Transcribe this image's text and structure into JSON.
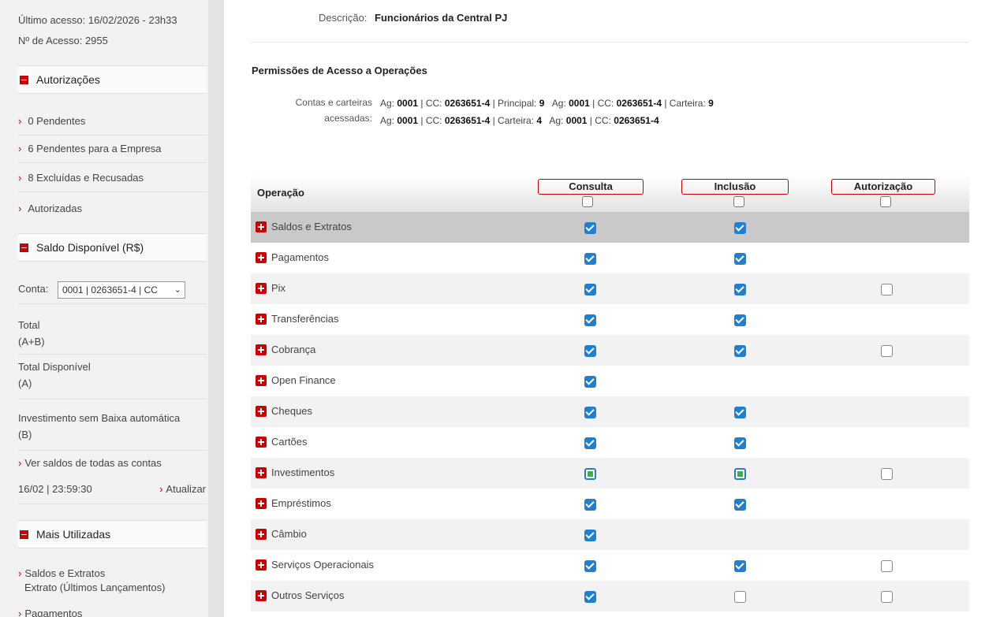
{
  "sidebar": {
    "last_access": "Último acesso: 16/02/2026 - 23h33",
    "access_count": "Nº de Acesso: 2955",
    "autorizacoes": {
      "title": "Autorizações",
      "items": [
        {
          "label": "0 Pendentes"
        },
        {
          "label": "6 Pendentes para a Empresa"
        },
        {
          "label": "8 Excluídas e Recusadas"
        },
        {
          "label": "Autorizadas"
        }
      ]
    },
    "saldo": {
      "title": "Saldo Disponível (R$)",
      "conta_label": "Conta:",
      "conta_value": "0001 | 0263651-4 | CC",
      "total_label": "Total",
      "total_sub": "(A+B)",
      "disponivel_label": "Total Disponível",
      "disponivel_sub": "(A)",
      "invest_label": "Investimento sem Baixa automática",
      "invest_sub": "(B)",
      "ver_saldos": "Ver saldos de todas as contas",
      "timestamp": "16/02 | 23:59:30",
      "atualizar": "Atualizar"
    },
    "mais_utilizadas": {
      "title": "Mais Utilizadas",
      "item1_line1": "Saldos e Extratos",
      "item1_line2": "Extrato (Últimos Lançamentos)",
      "item2": "Pagamentos"
    }
  },
  "main": {
    "descricao_label": "Descrição:",
    "descricao_value": "Funcionários da Central PJ",
    "permissions_title": "Permissões de Acesso a Operações",
    "contas_label_1": "Contas e carteiras",
    "contas_label_2": "acessadas:",
    "contas_line1": [
      {
        "t": "Ag: ",
        "b": false
      },
      {
        "t": "0001",
        "b": true
      },
      {
        "t": " | CC: ",
        "b": false
      },
      {
        "t": "0263651-4",
        "b": true
      },
      {
        "t": " | Principal: ",
        "b": false
      },
      {
        "t": "9",
        "b": true
      },
      {
        "t": "   Ag: ",
        "b": false
      },
      {
        "t": "0001",
        "b": true
      },
      {
        "t": " | CC: ",
        "b": false
      },
      {
        "t": "0263651-4",
        "b": true
      },
      {
        "t": " | Carteira: ",
        "b": false
      },
      {
        "t": "9",
        "b": true
      }
    ],
    "contas_line2": [
      {
        "t": "Ag: ",
        "b": false
      },
      {
        "t": "0001",
        "b": true
      },
      {
        "t": " | CC: ",
        "b": false
      },
      {
        "t": "0263651-4",
        "b": true
      },
      {
        "t": " | Carteira: ",
        "b": false
      },
      {
        "t": "4",
        "b": true
      },
      {
        "t": "   Ag: ",
        "b": false
      },
      {
        "t": "0001",
        "b": true
      },
      {
        "t": " | CC: ",
        "b": false
      },
      {
        "t": "0263651-4",
        "b": true
      }
    ],
    "table": {
      "col_operacao": "Operação",
      "col_consulta": "Consulta",
      "col_inclusao": "Inclusão",
      "col_autorizacao": "Autorização",
      "rows": [
        {
          "name": "Saldos e Extratos",
          "consulta": "checked",
          "inclusao": "checked",
          "autorizacao": "none"
        },
        {
          "name": "Pagamentos",
          "consulta": "checked",
          "inclusao": "checked",
          "autorizacao": "none"
        },
        {
          "name": "Pix",
          "consulta": "checked",
          "inclusao": "checked",
          "autorizacao": "unchecked"
        },
        {
          "name": "Transferências",
          "consulta": "checked",
          "inclusao": "checked",
          "autorizacao": "none"
        },
        {
          "name": "Cobrança",
          "consulta": "checked",
          "inclusao": "checked",
          "autorizacao": "unchecked"
        },
        {
          "name": "Open Finance",
          "consulta": "checked",
          "inclusao": "none",
          "autorizacao": "none"
        },
        {
          "name": "Cheques",
          "consulta": "checked",
          "inclusao": "checked",
          "autorizacao": "none"
        },
        {
          "name": "Cartões",
          "consulta": "checked",
          "inclusao": "checked",
          "autorizacao": "none"
        },
        {
          "name": "Investimentos",
          "consulta": "partial",
          "inclusao": "partial",
          "autorizacao": "unchecked"
        },
        {
          "name": "Empréstimos",
          "consulta": "checked",
          "inclusao": "checked",
          "autorizacao": "none"
        },
        {
          "name": "Câmbio",
          "consulta": "checked",
          "inclusao": "none",
          "autorizacao": "none"
        },
        {
          "name": "Serviços Operacionais",
          "consulta": "checked",
          "inclusao": "checked",
          "autorizacao": "unchecked"
        },
        {
          "name": "Outros Serviços",
          "consulta": "checked",
          "inclusao": "unchecked",
          "autorizacao": "unchecked"
        }
      ]
    }
  }
}
